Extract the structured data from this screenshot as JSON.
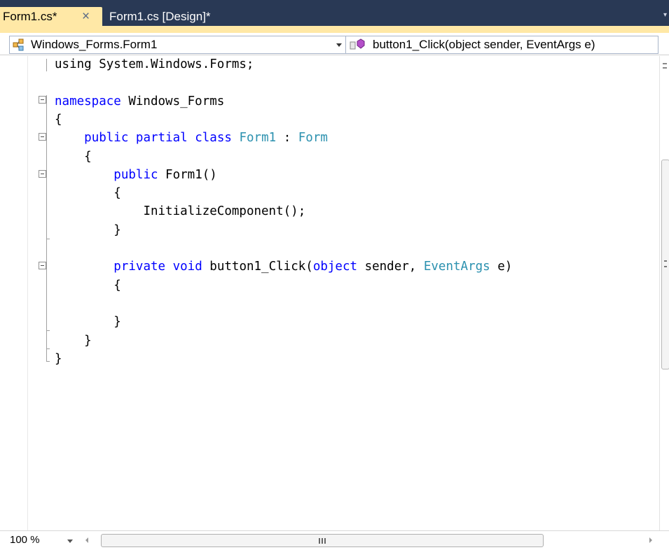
{
  "tabs": [
    {
      "label": "Form1.cs*",
      "active": true,
      "close_glyph": "×"
    },
    {
      "label": "Form1.cs [Design]*",
      "active": false
    }
  ],
  "navigation": {
    "type_selector": "Windows_Forms.Form1",
    "member_selector": "button1_Click(object sender, EventArgs e)"
  },
  "editor": {
    "lines": [
      {
        "indent": "",
        "tokens": [
          {
            "t": "using System.Windows.Forms;",
            "c": "plain"
          }
        ]
      },
      {
        "indent": "",
        "tokens": [
          {
            "t": "",
            "c": "plain"
          }
        ]
      },
      {
        "indent": "",
        "tokens": [
          {
            "t": "namespace",
            "c": "kw"
          },
          {
            "t": " Windows_Forms",
            "c": "plain"
          }
        ]
      },
      {
        "indent": "",
        "tokens": [
          {
            "t": "{",
            "c": "plain"
          }
        ]
      },
      {
        "indent": "    ",
        "tokens": [
          {
            "t": "public",
            "c": "kw"
          },
          {
            "t": " ",
            "c": "plain"
          },
          {
            "t": "partial",
            "c": "kw"
          },
          {
            "t": " ",
            "c": "plain"
          },
          {
            "t": "class",
            "c": "kw"
          },
          {
            "t": " ",
            "c": "plain"
          },
          {
            "t": "Form1",
            "c": "ty"
          },
          {
            "t": " : ",
            "c": "plain"
          },
          {
            "t": "Form",
            "c": "ty"
          }
        ]
      },
      {
        "indent": "    ",
        "tokens": [
          {
            "t": "{",
            "c": "plain"
          }
        ]
      },
      {
        "indent": "        ",
        "tokens": [
          {
            "t": "public",
            "c": "kw"
          },
          {
            "t": " Form1()",
            "c": "plain"
          }
        ]
      },
      {
        "indent": "        ",
        "tokens": [
          {
            "t": "{",
            "c": "plain"
          }
        ]
      },
      {
        "indent": "            ",
        "tokens": [
          {
            "t": "InitializeComponent();",
            "c": "plain"
          }
        ]
      },
      {
        "indent": "        ",
        "tokens": [
          {
            "t": "}",
            "c": "plain"
          }
        ]
      },
      {
        "indent": "",
        "tokens": [
          {
            "t": "",
            "c": "plain"
          }
        ]
      },
      {
        "indent": "        ",
        "tokens": [
          {
            "t": "private",
            "c": "kw"
          },
          {
            "t": " ",
            "c": "plain"
          },
          {
            "t": "void",
            "c": "kw"
          },
          {
            "t": " button1_Click(",
            "c": "plain"
          },
          {
            "t": "object",
            "c": "kw"
          },
          {
            "t": " sender, ",
            "c": "plain"
          },
          {
            "t": "EventArgs",
            "c": "ty"
          },
          {
            "t": " e)",
            "c": "plain"
          }
        ]
      },
      {
        "indent": "        ",
        "tokens": [
          {
            "t": "{",
            "c": "plain"
          }
        ]
      },
      {
        "indent": "",
        "tokens": [
          {
            "t": "",
            "c": "plain"
          }
        ]
      },
      {
        "indent": "        ",
        "tokens": [
          {
            "t": "}",
            "c": "plain"
          }
        ]
      },
      {
        "indent": "    ",
        "tokens": [
          {
            "t": "}",
            "c": "plain"
          }
        ]
      },
      {
        "indent": "",
        "tokens": [
          {
            "t": "}",
            "c": "plain"
          }
        ]
      }
    ]
  },
  "status": {
    "zoom": "100 %",
    "hscroll_grip": "III"
  },
  "colors": {
    "keyword": "#0000ff",
    "type": "#2b91af",
    "tab_active_bg": "#ffe8a6",
    "tabstrip_bg": "#293955"
  },
  "icons": {
    "type_selector": "class-icon",
    "member_selector": "method-icon"
  }
}
